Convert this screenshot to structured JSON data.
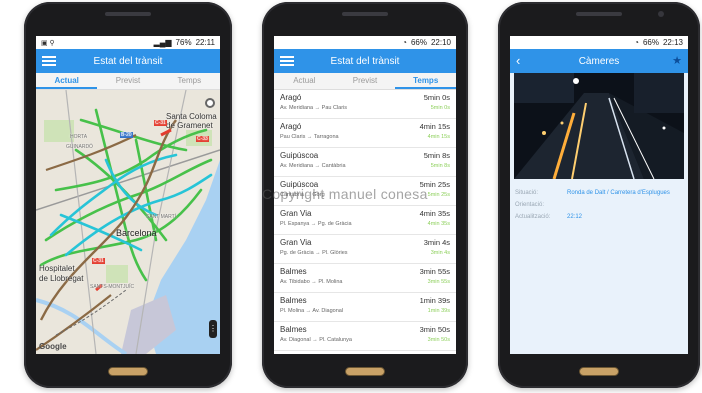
{
  "watermark": "Copyright manuel conesa",
  "phone1": {
    "status_time": "22:11",
    "status_battery": "76%",
    "title": "Estat del trànsit",
    "tabs": [
      "Actual",
      "Previst",
      "Temps"
    ],
    "map_labels": {
      "santa": "Santa Coloma",
      "gramenet": "de Gramenet",
      "barcelona": "Barcelona",
      "hospitalet": "Hospitalet",
      "llobregat": "de Llobregat",
      "horta": "HORTA",
      "guinardo": "GUINARDÓ",
      "sant_marti": "SANT MARTÍ",
      "santsmont": "SANTS-MONTJUÏC",
      "google": "Google"
    },
    "road_badges": [
      "C-31",
      "B-20",
      "C-33",
      "C-31"
    ]
  },
  "phone2": {
    "status_time": "22:10",
    "status_battery": "66%",
    "title": "Estat del trànsit",
    "tabs": [
      "Actual",
      "Previst",
      "Temps"
    ],
    "items": [
      {
        "name": "Aragó",
        "route": "Av. Meridiana → Pau Claris",
        "time": "5min 0s",
        "sub": "5min 0s"
      },
      {
        "name": "Aragó",
        "route": "Pau Claris → Tarragona",
        "time": "4min 15s",
        "sub": "4min 15s"
      },
      {
        "name": "Guipúscoa",
        "route": "Av. Meridiana → Cantàbria",
        "time": "5min 8s",
        "sub": "5min 8s"
      },
      {
        "name": "Guipúscoa",
        "route": "Cantàbria → Gorg",
        "time": "5min 25s",
        "sub": "5min 25s"
      },
      {
        "name": "Gran Via",
        "route": "Pl. Espanya → Pg. de Gràcia",
        "time": "4min 35s",
        "sub": "4min 35s"
      },
      {
        "name": "Gran Via",
        "route": "Pg. de Gràcia → Pl. Glòries",
        "time": "3min 4s",
        "sub": "3min 4s"
      },
      {
        "name": "Balmes",
        "route": "Av. Tibidabo → Pl. Molina",
        "time": "3min 55s",
        "sub": "3min 55s"
      },
      {
        "name": "Balmes",
        "route": "Pl. Molina → Av. Diagonal",
        "time": "1min 39s",
        "sub": "1min 39s"
      },
      {
        "name": "Balmes",
        "route": "Av. Diagonal → Pl. Catalunya",
        "time": "3min 50s",
        "sub": "3min 50s"
      }
    ]
  },
  "phone3": {
    "status_time": "22:13",
    "status_battery": "66%",
    "title": "Càmeres",
    "rows": [
      {
        "k": "Situació:",
        "v": "Ronda de Dalt / Carretera d'Esplugues"
      },
      {
        "k": "Orientació:",
        "v": ""
      },
      {
        "k": "Actualització:",
        "v": "22:12"
      }
    ]
  },
  "colors": {
    "accent": "#2f93e8",
    "green": "#8ccf5a"
  }
}
